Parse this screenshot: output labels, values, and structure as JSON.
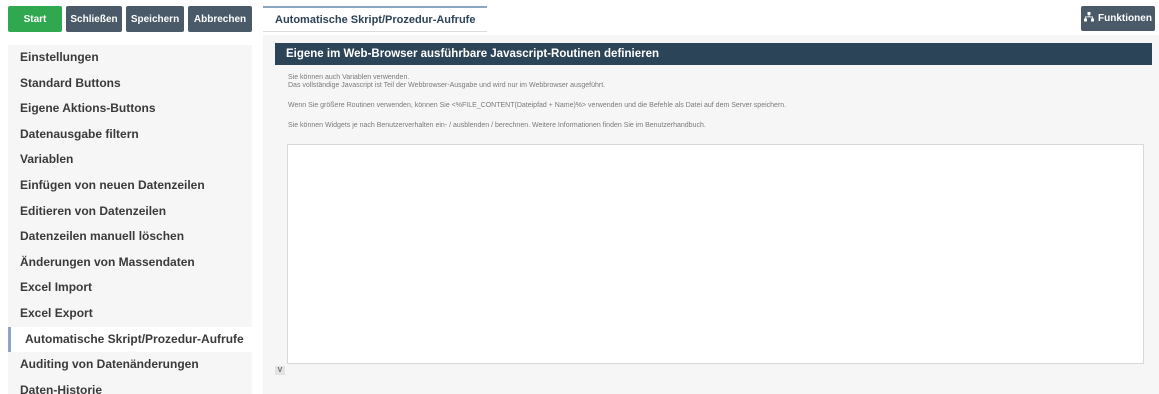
{
  "toolbar": {
    "start": "Start",
    "close": "Schließen",
    "save": "Speichern",
    "cancel": "Abbrechen"
  },
  "sidebar": {
    "items": [
      {
        "label": "Einstellungen"
      },
      {
        "label": "Standard Buttons"
      },
      {
        "label": "Eigene Aktions-Buttons"
      },
      {
        "label": "Datenausgabe filtern"
      },
      {
        "label": "Variablen"
      },
      {
        "label": "Einfügen von neuen Datenzeilen"
      },
      {
        "label": "Editieren von Datenzeilen"
      },
      {
        "label": "Datenzeilen manuell löschen"
      },
      {
        "label": "Änderungen von Massendaten"
      },
      {
        "label": "Excel Import"
      },
      {
        "label": "Excel Export"
      },
      {
        "label": "Automatische Skript/Prozedur-Aufrufe"
      },
      {
        "label": "Auditing von Datenänderungen"
      },
      {
        "label": "Daten-Historie"
      }
    ],
    "active_index": 11
  },
  "tab": {
    "label": "Automatische Skript/Prozedur-Aufrufe"
  },
  "functions_button": {
    "label": "Funktionen",
    "icon": "sitemap-icon"
  },
  "section": {
    "title": "Eigene im Web-Browser ausführbare Javascript-Routinen definieren",
    "info_lines": [
      "Sie können auch Variablen verwenden.",
      "Das vollständige Javascript ist Teil der Webbrowser-Ausgabe und wird nur im Webbrowser ausgeführt.",
      "Wenn Sie größere Routinen verwenden, können Sie <%FILE_CONTENT(Dateipfad + Name)%> verwenden und die Befehle als Datei auf dem Server speichern.",
      "Sie können Widgets je nach Benutzerverhalten ein- / ausblenden / berechnen. Weitere Informationen finden Sie im Benutzerhandbuch."
    ],
    "code_value": "",
    "resize_label": "V"
  },
  "colors": {
    "start": "#2fa84f",
    "toolbar_dark": "#4a5a68",
    "section_header": "#2c4457",
    "active_accent": "#8ba6c4"
  }
}
